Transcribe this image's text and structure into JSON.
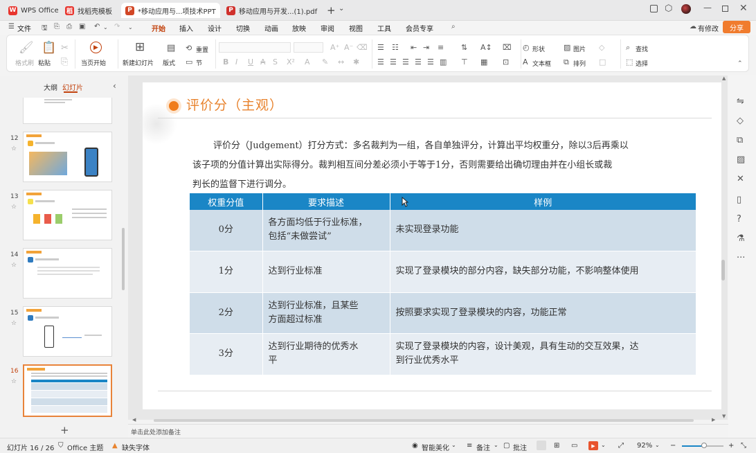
{
  "titlebar": {
    "tabs": [
      {
        "label": "WPS Office",
        "icon": "wps-logo-icon"
      },
      {
        "label": "找稻壳模板",
        "icon": "docer-icon"
      },
      {
        "label": "*移动应用与...项技术PPT",
        "icon": "ppt-icon"
      },
      {
        "label": "移动应用与开发...(1).pdf",
        "icon": "pdf-icon"
      }
    ],
    "new_tab": "+",
    "tab_list": "⌄"
  },
  "menubar": {
    "file": "文件",
    "items": [
      "开始",
      "插入",
      "设计",
      "切换",
      "动画",
      "放映",
      "审阅",
      "视图",
      "工具",
      "会员专享"
    ],
    "active": "开始",
    "modified": "有修改",
    "share": "分享"
  },
  "ribbon": {
    "format_painter": "格式刷",
    "paste": "粘贴",
    "start_from_current": "当页开始",
    "new_slide": "新建幻灯片",
    "layout": "版式",
    "reset": "重置",
    "section": "节",
    "shape": "形状",
    "picture": "图片",
    "find": "查找",
    "textbox": "文本框",
    "arrange": "排列",
    "select": "选择"
  },
  "leftpanel": {
    "tab_outline": "大纲",
    "tab_slides": "幻灯片",
    "slides": [
      {
        "num": "12"
      },
      {
        "num": "13"
      },
      {
        "num": "14"
      },
      {
        "num": "15"
      },
      {
        "num": "16"
      }
    ],
    "add_slide": "+"
  },
  "slide": {
    "title": "评价分（主观）",
    "body_lines": [
      "评价分（Judgement）打分方式：多名裁判为一组，各自单独评分，计算出平均权重分，除以3后再乘以",
      "该子项的分值计算出实际得分。裁判相互间分差必须小于等于1分，否则需要给出确切理由并在小组长或裁",
      "判长的监督下进行调分。"
    ],
    "table": {
      "headers": [
        "权重分值",
        "要求描述",
        "样例"
      ],
      "rows": [
        {
          "score": "0分",
          "desc": [
            "各方面均低于行业标准，",
            "包括“未做尝试”"
          ],
          "example": [
            "未实现登录功能"
          ]
        },
        {
          "score": "1分",
          "desc": [
            "达到行业标准"
          ],
          "example": [
            "实现了登录模块的部分内容，缺失部分功能，不影响整体使用"
          ]
        },
        {
          "score": "2分",
          "desc": [
            "达到行业标准，且某些",
            "方面超过标准"
          ],
          "example": [
            "按照要求实现了登录模块的内容，功能正常"
          ]
        },
        {
          "score": "3分",
          "desc": [
            "达到行业期待的优秀水",
            "平"
          ],
          "example": [
            "实现了登录模块的内容，设计美观，具有生动的交互效果，达",
            "到行业优秀水平"
          ]
        }
      ]
    }
  },
  "notes_placeholder": "单击此处添加备注",
  "statusbar": {
    "slide_counter": "幻灯片 16 / 26",
    "theme": "Office 主题",
    "missing_font": "缺失字体",
    "smart_beautify": "智能美化",
    "notes": "备注",
    "comments": "批注",
    "zoom": "92%"
  },
  "colors": {
    "accent": "#c2410c",
    "share_button": "#f07c2e",
    "table_header": "#1a86c6",
    "table_row_dark": "#cfdde9",
    "table_row_light": "#e7edf3",
    "title_orange": "#e8832e"
  }
}
